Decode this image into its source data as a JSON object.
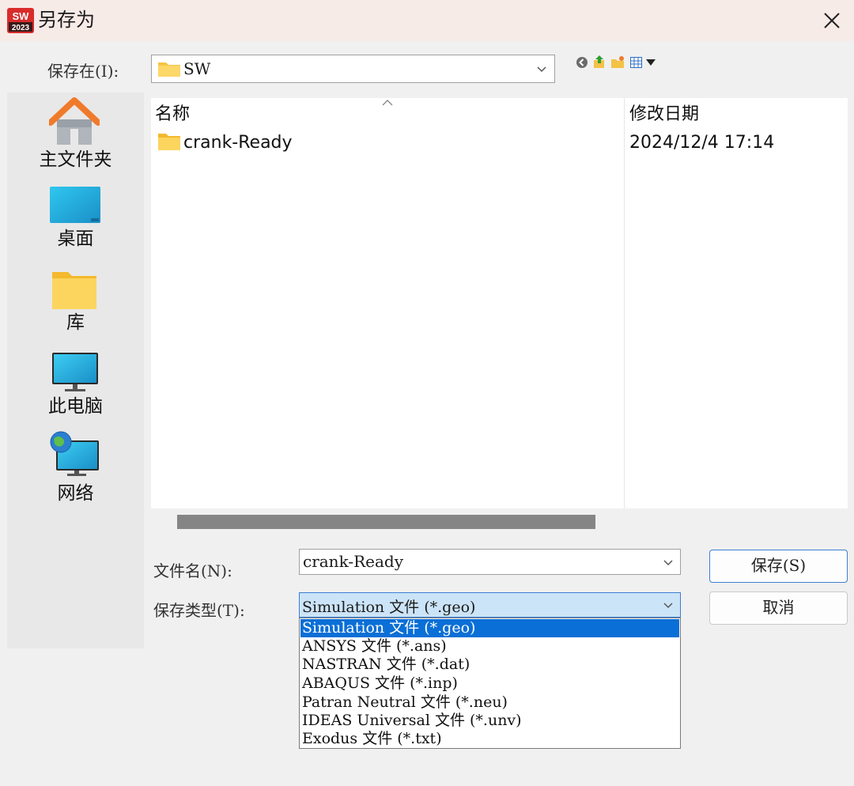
{
  "window": {
    "title": "另存为",
    "app_logo_text": "SW 2023",
    "brand_color": "#d92b2b"
  },
  "location": {
    "label": "保存在(I):",
    "current": "SW",
    "toolbar_icons": [
      "back-icon",
      "up-folder-icon",
      "new-folder-icon",
      "view-menu-icon"
    ]
  },
  "places": [
    {
      "label": "主文件夹",
      "icon": "home-icon"
    },
    {
      "label": "桌面",
      "icon": "desktop-icon"
    },
    {
      "label": "库",
      "icon": "library-folder-icon"
    },
    {
      "label": "此电脑",
      "icon": "computer-icon"
    },
    {
      "label": "网络",
      "icon": "network-icon"
    }
  ],
  "filelist": {
    "columns": [
      "名称",
      "修改日期"
    ],
    "rows": [
      {
        "name": "crank-Ready",
        "modified": "2024/12/4 17:14",
        "icon": "folder-icon"
      }
    ]
  },
  "filename": {
    "label": "文件名(N):",
    "value": "crank-Ready"
  },
  "filetype": {
    "label": "保存类型(T):",
    "value": "Simulation 文件 (*.geo)",
    "options": [
      "Simulation 文件 (*.geo)",
      "ANSYS 文件 (*.ans)",
      "NASTRAN 文件 (*.dat)",
      "ABAQUS 文件 (*.inp)",
      "Patran Neutral 文件 (*.neu)",
      "IDEAS Universal 文件 (*.unv)",
      "Exodus 文件 (*.txt)"
    ],
    "selected_index": 0
  },
  "buttons": {
    "save": "保存(S)",
    "cancel": "取消"
  }
}
